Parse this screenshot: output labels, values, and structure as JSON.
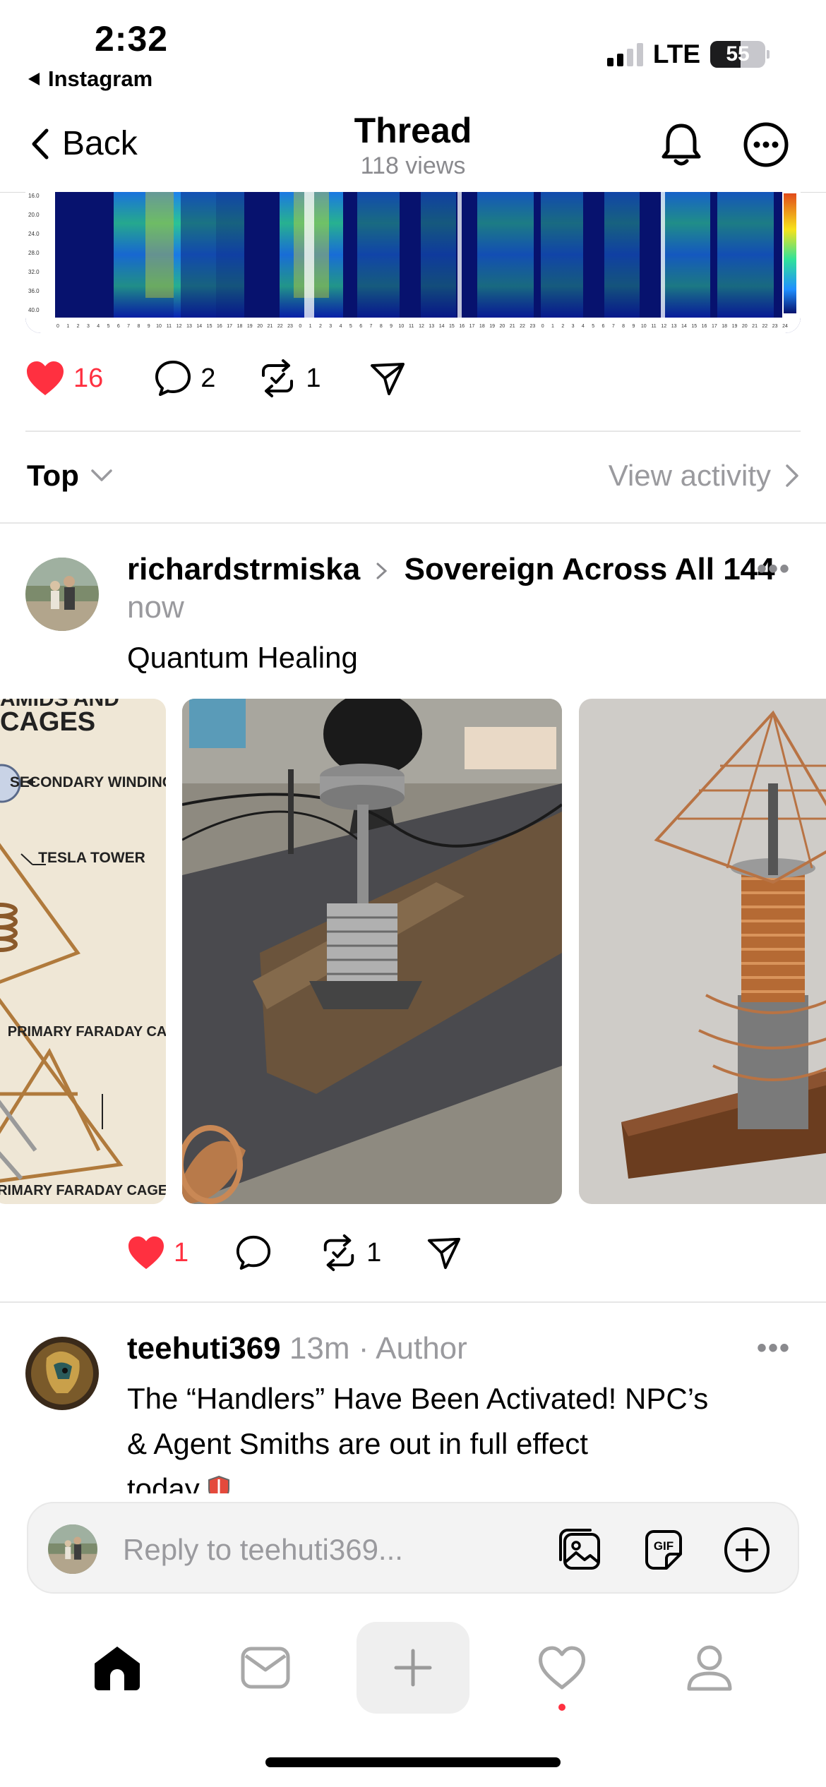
{
  "status_bar": {
    "time": "2:32",
    "back_app": "Instagram",
    "network": "LTE",
    "battery": "55",
    "battery_level": 0.55
  },
  "nav": {
    "back_label": "Back",
    "title": "Thread",
    "views": "118 views"
  },
  "spectrogram": {
    "y_ticks": [
      "16.0",
      "20.0",
      "24.0",
      "28.0",
      "32.0",
      "36.0",
      "40.0"
    ],
    "x_ticks": [
      "0",
      "1",
      "2",
      "3",
      "4",
      "5",
      "6",
      "7",
      "8",
      "9",
      "10",
      "11",
      "12",
      "13",
      "14",
      "15",
      "16",
      "17",
      "18",
      "19",
      "20",
      "21",
      "22",
      "23",
      "0",
      "1",
      "2",
      "3",
      "4",
      "5",
      "6",
      "7",
      "8",
      "9",
      "10",
      "11",
      "12",
      "13",
      "14",
      "15",
      "16",
      "17",
      "18",
      "19",
      "20",
      "21",
      "22",
      "23",
      "0",
      "1",
      "2",
      "3",
      "4",
      "5",
      "6",
      "7",
      "8",
      "9",
      "10",
      "11",
      "12",
      "13",
      "14",
      "15",
      "16",
      "17",
      "18",
      "19",
      "20",
      "21",
      "22",
      "23",
      "24"
    ],
    "colors": [
      "#07126e",
      "#0a2bd6",
      "#1f8fff",
      "#31e29a",
      "#f7e21b",
      "#e14b1b"
    ]
  },
  "main_post_actions": {
    "likes": "16",
    "comments": "2",
    "reposts": "1",
    "liked": true,
    "like_color": "#ff3040"
  },
  "sort": {
    "label": "Top",
    "view_activity": "View activity"
  },
  "reply1": {
    "username": "richardstrmiska",
    "community": "Sovereign Across All 144",
    "time": "now",
    "text": "Quantum Healing",
    "diagram_labels": {
      "title_partial": "AMIDS AND",
      "title": "CAGES",
      "secondary_winding": "SECONDARY WINDING",
      "tesla_tower": "TESLA TOWER",
      "primary_faraday_cage": "PRIMARY FARADAY CAGE",
      "primary_faraday_cage_2": "PRIMARY FARADAY CAGE"
    },
    "actions": {
      "likes": "1",
      "reposts": "1",
      "liked": true
    }
  },
  "reply2": {
    "username": "teehuti369",
    "time": "13m",
    "author_tag": "Author",
    "text_line1": "The “Handlers” Have Been Activated! NPC’s",
    "text_line2": "& Agent Smiths are out in full effect",
    "text_line3": "today"
  },
  "reply_bar": {
    "placeholder": "Reply to teehuti369..."
  },
  "tab_bar": {
    "items": [
      "home-icon",
      "inbox-icon",
      "compose-icon",
      "activity-icon",
      "profile-icon"
    ],
    "active": "home-icon"
  }
}
